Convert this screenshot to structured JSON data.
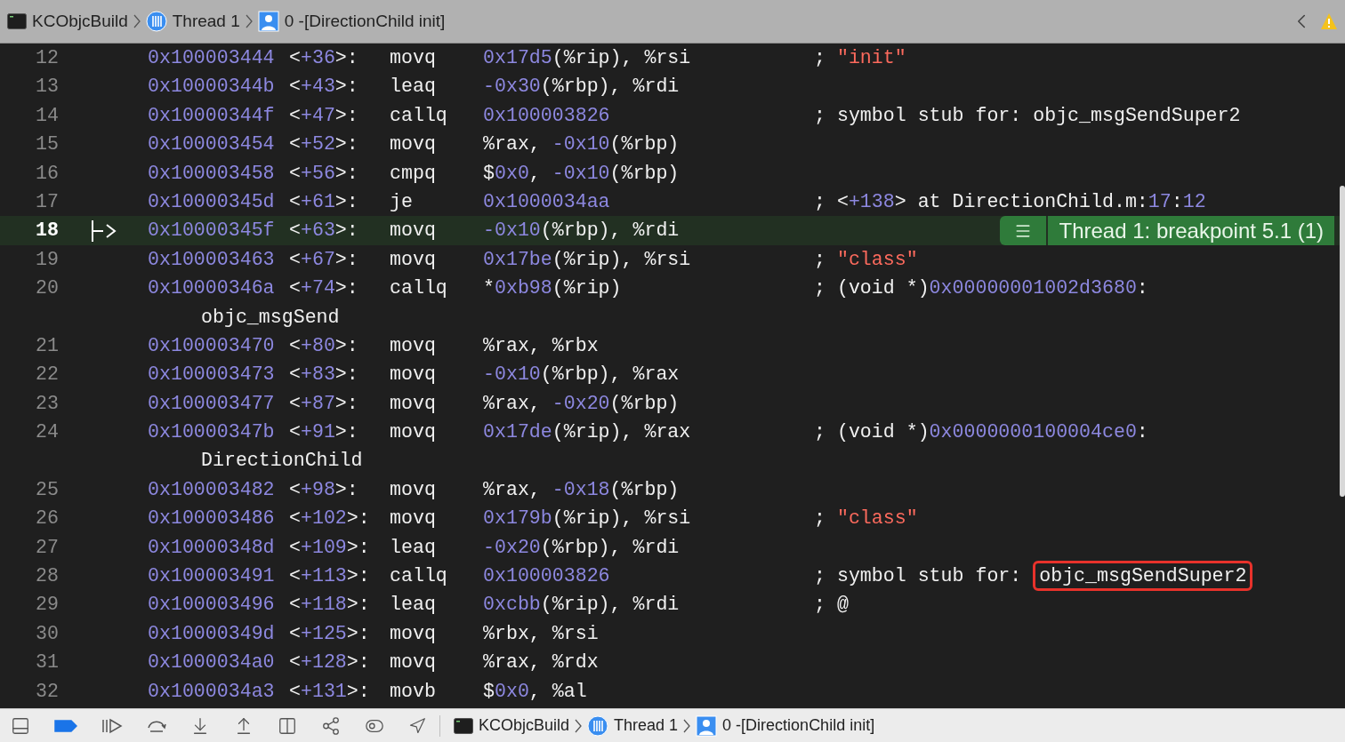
{
  "top_bar": {
    "breadcrumbs": [
      {
        "kind": "app",
        "label": "KCObjcBuild"
      },
      {
        "kind": "thread",
        "label": "Thread 1"
      },
      {
        "kind": "frame",
        "label": "0 -[DirectionChild init]"
      }
    ]
  },
  "lines": [
    {
      "n": "12",
      "addr": "0x100003444",
      "off": [
        {
          "t": "<"
        },
        {
          "t": "+36",
          "kind": "number"
        },
        {
          "t": ">:"
        }
      ],
      "op": "movq",
      "args": [
        {
          "t": "0x17d5",
          "kind": "number"
        },
        {
          "t": "(%rip), %rsi"
        }
      ],
      "comment": [
        {
          "t": "; "
        },
        {
          "t": "\"init\"",
          "kind": "string"
        }
      ],
      "current": false
    },
    {
      "n": "13",
      "addr": "0x10000344b",
      "off": [
        {
          "t": "<"
        },
        {
          "t": "+43",
          "kind": "number"
        },
        {
          "t": ">:"
        }
      ],
      "op": "leaq",
      "args": [
        {
          "t": "-0x30",
          "kind": "number"
        },
        {
          "t": "(%rbp), %rdi"
        }
      ],
      "current": false
    },
    {
      "n": "14",
      "addr": "0x10000344f",
      "off": [
        {
          "t": "<"
        },
        {
          "t": "+47",
          "kind": "number"
        },
        {
          "t": ">:"
        }
      ],
      "op": "callq",
      "args": [
        {
          "t": "0x100003826",
          "kind": "number"
        }
      ],
      "comment": [
        {
          "t": "; symbol stub for: objc_msgSendSuper2"
        }
      ],
      "current": false
    },
    {
      "n": "15",
      "addr": "0x100003454",
      "off": [
        {
          "t": "<"
        },
        {
          "t": "+52",
          "kind": "number"
        },
        {
          "t": ">:"
        }
      ],
      "op": "movq",
      "args": [
        {
          "t": "%rax, "
        },
        {
          "t": "-0x10",
          "kind": "number"
        },
        {
          "t": "(%rbp)"
        }
      ],
      "current": false
    },
    {
      "n": "16",
      "addr": "0x100003458",
      "off": [
        {
          "t": "<"
        },
        {
          "t": "+56",
          "kind": "number"
        },
        {
          "t": ">:"
        }
      ],
      "op": "cmpq",
      "args": [
        {
          "t": "$"
        },
        {
          "t": "0x0",
          "kind": "number"
        },
        {
          "t": ", "
        },
        {
          "t": "-0x10",
          "kind": "number"
        },
        {
          "t": "(%rbp)"
        }
      ],
      "current": false
    },
    {
      "n": "17",
      "addr": "0x10000345d",
      "off": [
        {
          "t": "<"
        },
        {
          "t": "+61",
          "kind": "number"
        },
        {
          "t": ">:"
        }
      ],
      "op": "je",
      "args": [
        {
          "t": "0x1000034aa",
          "kind": "number"
        }
      ],
      "comment": [
        {
          "t": "; <"
        },
        {
          "t": "+138",
          "kind": "number"
        },
        {
          "t": "> at DirectionChild.m:"
        },
        {
          "t": "17",
          "kind": "number"
        },
        {
          "t": ":"
        },
        {
          "t": "12",
          "kind": "number"
        }
      ],
      "current": false
    },
    {
      "n": "18",
      "addr": "0x10000345f",
      "off": [
        {
          "t": "<"
        },
        {
          "t": "+63",
          "kind": "number"
        },
        {
          "t": ">:"
        }
      ],
      "op": "movq",
      "args": [
        {
          "t": "-0x10",
          "kind": "number"
        },
        {
          "t": "(%rbp), %rdi"
        }
      ],
      "current": true,
      "badge": "Thread 1: breakpoint 5.1 (1)"
    },
    {
      "n": "19",
      "addr": "0x100003463",
      "off": [
        {
          "t": "<"
        },
        {
          "t": "+67",
          "kind": "number"
        },
        {
          "t": ">:"
        }
      ],
      "op": "movq",
      "args": [
        {
          "t": "0x17be",
          "kind": "number"
        },
        {
          "t": "(%rip), %rsi"
        }
      ],
      "comment": [
        {
          "t": "; "
        },
        {
          "t": "\"class\"",
          "kind": "string"
        }
      ],
      "current": false
    },
    {
      "n": "20",
      "addr": "0x10000346a",
      "off": [
        {
          "t": "<"
        },
        {
          "t": "+74",
          "kind": "number"
        },
        {
          "t": ">:"
        }
      ],
      "op": "callq",
      "args": [
        {
          "t": "*"
        },
        {
          "t": "0xb98",
          "kind": "number"
        },
        {
          "t": "(%rip)"
        }
      ],
      "comment": [
        {
          "t": "; (void *)"
        },
        {
          "t": "0x00000001002d3680",
          "kind": "number"
        },
        {
          "t": ":"
        }
      ],
      "wrap": "objc_msgSend",
      "current": false
    },
    {
      "n": "21",
      "addr": "0x100003470",
      "off": [
        {
          "t": "<"
        },
        {
          "t": "+80",
          "kind": "number"
        },
        {
          "t": ">:"
        }
      ],
      "op": "movq",
      "args": [
        {
          "t": "%rax, %rbx"
        }
      ],
      "current": false
    },
    {
      "n": "22",
      "addr": "0x100003473",
      "off": [
        {
          "t": "<"
        },
        {
          "t": "+83",
          "kind": "number"
        },
        {
          "t": ">:"
        }
      ],
      "op": "movq",
      "args": [
        {
          "t": "-0x10",
          "kind": "number"
        },
        {
          "t": "(%rbp), %rax"
        }
      ],
      "current": false
    },
    {
      "n": "23",
      "addr": "0x100003477",
      "off": [
        {
          "t": "<"
        },
        {
          "t": "+87",
          "kind": "number"
        },
        {
          "t": ">:"
        }
      ],
      "op": "movq",
      "args": [
        {
          "t": "%rax, "
        },
        {
          "t": "-0x20",
          "kind": "number"
        },
        {
          "t": "(%rbp)"
        }
      ],
      "current": false
    },
    {
      "n": "24",
      "addr": "0x10000347b",
      "off": [
        {
          "t": "<"
        },
        {
          "t": "+91",
          "kind": "number"
        },
        {
          "t": ">:"
        }
      ],
      "op": "movq",
      "args": [
        {
          "t": "0x17de",
          "kind": "number"
        },
        {
          "t": "(%rip), %rax"
        }
      ],
      "comment": [
        {
          "t": "; (void *)"
        },
        {
          "t": "0x0000000100004ce0",
          "kind": "number"
        },
        {
          "t": ":"
        }
      ],
      "wrap": "DirectionChild",
      "current": false
    },
    {
      "n": "25",
      "addr": "0x100003482",
      "off": [
        {
          "t": "<"
        },
        {
          "t": "+98",
          "kind": "number"
        },
        {
          "t": ">:"
        }
      ],
      "op": "movq",
      "args": [
        {
          "t": "%rax, "
        },
        {
          "t": "-0x18",
          "kind": "number"
        },
        {
          "t": "(%rbp)"
        }
      ],
      "current": false
    },
    {
      "n": "26",
      "addr": "0x100003486",
      "off": [
        {
          "t": "<"
        },
        {
          "t": "+102",
          "kind": "number"
        },
        {
          "t": ">:"
        }
      ],
      "op": "movq",
      "args": [
        {
          "t": "0x179b",
          "kind": "number"
        },
        {
          "t": "(%rip), %rsi"
        }
      ],
      "comment": [
        {
          "t": "; "
        },
        {
          "t": "\"class\"",
          "kind": "string"
        }
      ],
      "current": false
    },
    {
      "n": "27",
      "addr": "0x10000348d",
      "off": [
        {
          "t": "<"
        },
        {
          "t": "+109",
          "kind": "number"
        },
        {
          "t": ">:"
        }
      ],
      "op": "leaq",
      "args": [
        {
          "t": "-0x20",
          "kind": "number"
        },
        {
          "t": "(%rbp), %rdi"
        }
      ],
      "current": false
    },
    {
      "n": "28",
      "addr": "0x100003491",
      "off": [
        {
          "t": "<"
        },
        {
          "t": "+113",
          "kind": "number"
        },
        {
          "t": ">:"
        }
      ],
      "op": "callq",
      "args": [
        {
          "t": "0x100003826",
          "kind": "number"
        }
      ],
      "comment": [
        {
          "t": "; symbol stub for: "
        },
        {
          "t": "objc_msgSendSuper2",
          "boxed": true
        }
      ],
      "current": false
    },
    {
      "n": "29",
      "addr": "0x100003496",
      "off": [
        {
          "t": "<"
        },
        {
          "t": "+118",
          "kind": "number"
        },
        {
          "t": ">:"
        }
      ],
      "op": "leaq",
      "args": [
        {
          "t": "0xcbb",
          "kind": "number"
        },
        {
          "t": "(%rip), %rdi"
        }
      ],
      "comment": [
        {
          "t": "; @"
        }
      ],
      "current": false
    },
    {
      "n": "30",
      "addr": "0x10000349d",
      "off": [
        {
          "t": "<"
        },
        {
          "t": "+125",
          "kind": "number"
        },
        {
          "t": ">:"
        }
      ],
      "op": "movq",
      "args": [
        {
          "t": "%rbx, %rsi"
        }
      ],
      "current": false
    },
    {
      "n": "31",
      "addr": "0x1000034a0",
      "off": [
        {
          "t": "<"
        },
        {
          "t": "+128",
          "kind": "number"
        },
        {
          "t": ">:"
        }
      ],
      "op": "movq",
      "args": [
        {
          "t": "%rax, %rdx"
        }
      ],
      "current": false
    },
    {
      "n": "32",
      "addr": "0x1000034a3",
      "off": [
        {
          "t": "<"
        },
        {
          "t": "+131",
          "kind": "number"
        },
        {
          "t": ">:"
        }
      ],
      "op": "movb",
      "args": [
        {
          "t": "$"
        },
        {
          "t": "0x0",
          "kind": "number"
        },
        {
          "t": ", %al"
        }
      ],
      "current": false
    }
  ],
  "bottom_bar": {
    "breakpoints_active": true,
    "breadcrumbs": [
      {
        "kind": "app",
        "label": "KCObjcBuild"
      },
      {
        "kind": "thread",
        "label": "Thread 1"
      },
      {
        "kind": "frame",
        "label": "0 -[DirectionChild init]"
      }
    ]
  }
}
